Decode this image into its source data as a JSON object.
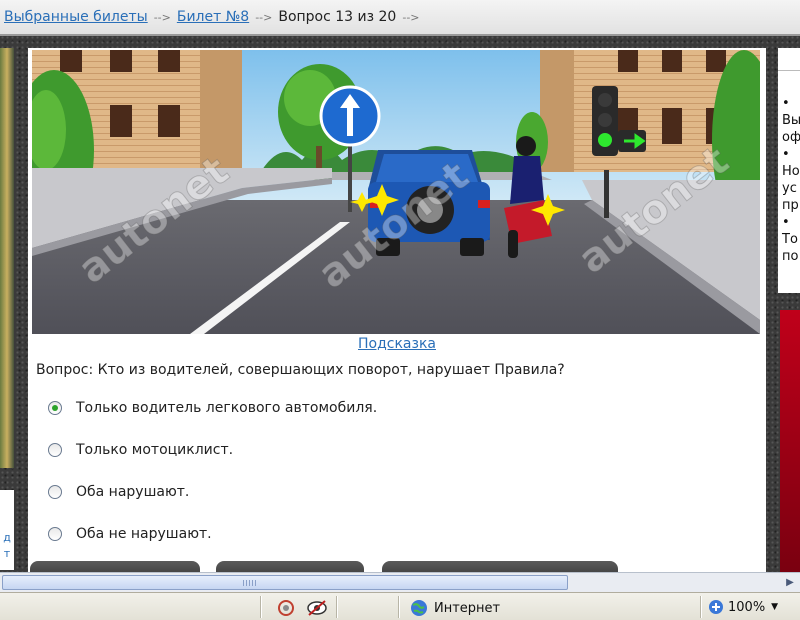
{
  "breadcrumb": {
    "items": [
      "Выбранные билеты",
      "Билет №8",
      "Вопрос 13 из 20"
    ],
    "separator": "-->"
  },
  "scene": {
    "watermarks": [
      "autonet",
      "autonet",
      "autonet"
    ]
  },
  "hint_label": "Подсказка",
  "question": "Вопрос: Кто из водителей, совершающих поворот, нарушает Правила?",
  "options": [
    {
      "label": "Только водитель легкового автомобиля.",
      "checked": true
    },
    {
      "label": "Только мотоциклист.",
      "checked": false
    },
    {
      "label": "Оба нарушают.",
      "checked": false
    },
    {
      "label": "Оба не нарушают.",
      "checked": false
    }
  ],
  "left_sidebar_fragment": [
    "д",
    "т"
  ],
  "right_sidebar_fragment": [
    "•",
    "Вы",
    "оф",
    "•",
    "Но",
    "ус",
    "пр",
    "•",
    "То",
    "по"
  ],
  "status": {
    "zone": "Интернет",
    "zoom": "100%"
  }
}
